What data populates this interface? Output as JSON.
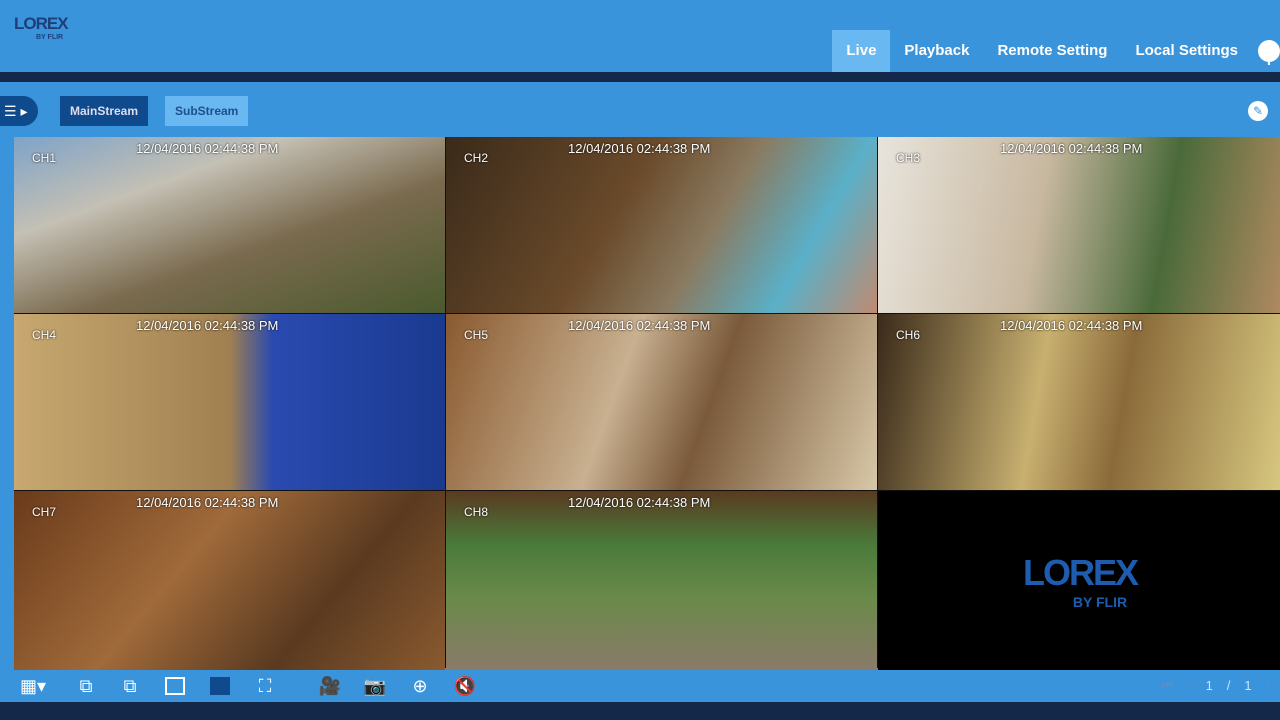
{
  "header": {
    "logo": "LOREX",
    "logo_sub": "BY FLIR",
    "nav": [
      "Live",
      "Playback",
      "Remote Setting",
      "Local Settings"
    ],
    "active": "Live",
    "info_icon": "i"
  },
  "toolbar": {
    "main_stream": "MainStream",
    "sub_stream": "SubStream",
    "menu_icon": "☰ ▸",
    "edit_icon": "✎"
  },
  "channels": [
    {
      "label": "CH1",
      "timestamp": "12/04/2016  02:44:38 PM"
    },
    {
      "label": "CH2",
      "timestamp": "12/04/2016  02:44:38 PM"
    },
    {
      "label": "CH3",
      "timestamp": "12/04/2016  02:44:38 PM"
    },
    {
      "label": "CH4",
      "timestamp": "12/04/2016  02:44:38 PM"
    },
    {
      "label": "CH5",
      "timestamp": "12/04/2016  02:44:38 PM"
    },
    {
      "label": "CH6",
      "timestamp": "12/04/2016  02:44:38 PM"
    },
    {
      "label": "CH7",
      "timestamp": "12/04/2016  02:44:38 PM"
    },
    {
      "label": "CH8",
      "timestamp": "12/04/2016  02:44:38 PM"
    }
  ],
  "empty_cell": {
    "logo": "LOREX",
    "logo_sub": "BY FLIR"
  },
  "bottom": {
    "pager": {
      "first": "⏮",
      "prev": "‹",
      "current": "1",
      "sep": "/",
      "total": "1",
      "next": "›"
    }
  },
  "colors": {
    "header": "#3a94dc",
    "dark": "#14284a",
    "active_tab": "#6ab8f2",
    "main_stream": "#0e4a8c"
  }
}
